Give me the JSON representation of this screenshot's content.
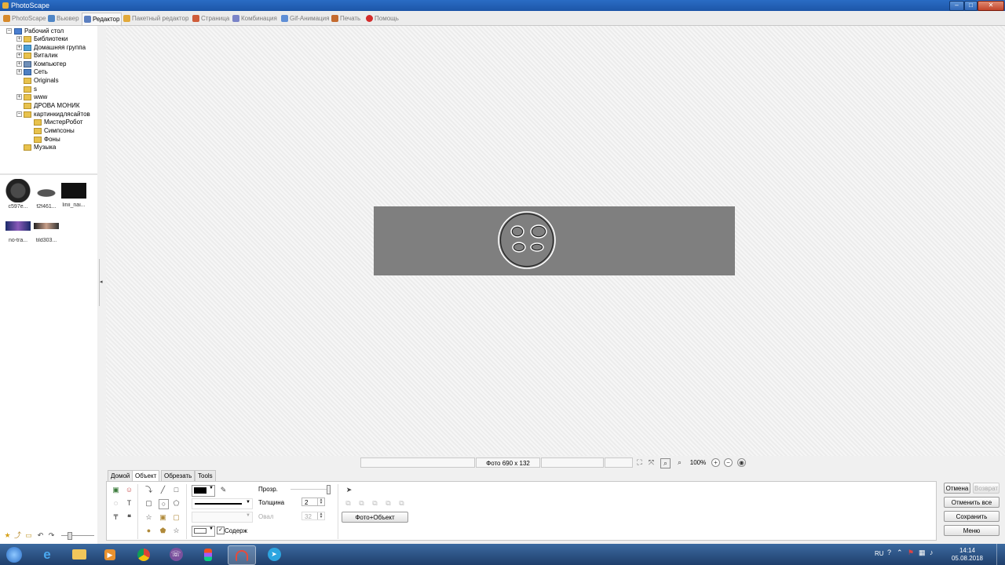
{
  "window": {
    "title": "PhotoScape"
  },
  "tabs": [
    {
      "label": "PhotoScape",
      "color": "#d6892a"
    },
    {
      "label": "Вьювер",
      "color": "#4f86c6"
    },
    {
      "label": "Редактор",
      "color": "#5b7fc0"
    },
    {
      "label": "Пакетный редактор",
      "color": "#e2a93a"
    },
    {
      "label": "Страница",
      "color": "#cf5d3a"
    },
    {
      "label": "Комбинация",
      "color": "#7a84c8"
    },
    {
      "label": "Gif-Анимация",
      "color": "#5f8fd6"
    },
    {
      "label": "Печать",
      "color": "#c46b2f"
    },
    {
      "label": "Помощь",
      "color": "#d32b2b"
    }
  ],
  "tree": {
    "root": "Рабочий стол",
    "items": [
      "Библиотеки",
      "Домашняя группа",
      "Виталик",
      "Компьютер",
      "Сеть",
      "Originals",
      "s",
      "www",
      "ДРОВА МОНИК",
      "картинкидлясайтов",
      "МистерРобот",
      "Симпсоны",
      "Фоны",
      "Музыка"
    ]
  },
  "thumbnails": [
    {
      "caption": "c597e..."
    },
    {
      "caption": "f2f461..."
    },
    {
      "caption": "linii_nai..."
    },
    {
      "caption": "no-tra..."
    },
    {
      "caption": "tild303..."
    }
  ],
  "status": {
    "photo_size": "Фото 690 x 132",
    "zoom": "100%"
  },
  "tool_tabs": [
    "Домой",
    "Объект",
    "Обрезать",
    "Tools"
  ],
  "object_panel": {
    "opacity_label": "Прозр.",
    "thickness_label": "Толщина",
    "thickness_value": "2",
    "oval_label": "Овал",
    "oval_value": "32",
    "contain_label": "Содерж",
    "photo_object_button": "Фото+Объект"
  },
  "right_buttons": {
    "undo": "Отмена",
    "redo": "Возврат",
    "undo_all": "Отменить все",
    "save": "Сохранить",
    "menu": "Меню"
  },
  "taskbar": {
    "lang": "RU",
    "time": "14:14",
    "date": "05.08.2018"
  }
}
